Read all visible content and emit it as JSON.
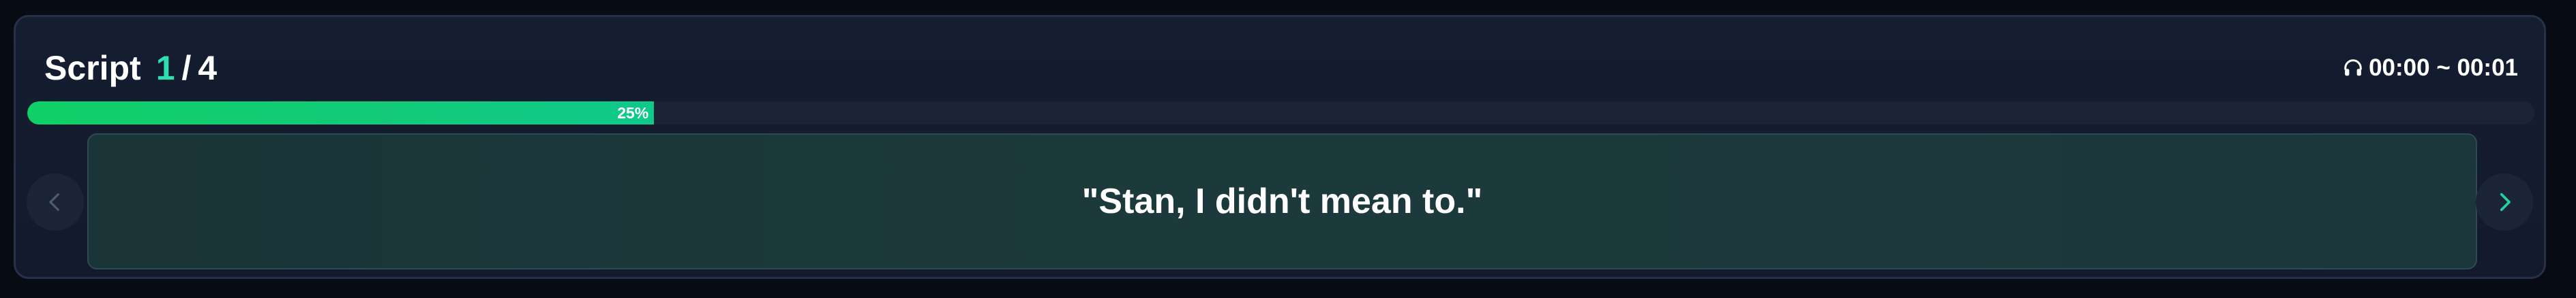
{
  "header": {
    "title_label": "Script",
    "current_index": "1",
    "separator": "/",
    "total": "4"
  },
  "time_range": "00:00 ~ 00:01",
  "progress": {
    "percent": 25,
    "label": "25%"
  },
  "script_line": "\"Stan, I didn't mean to.\"",
  "icons": {
    "time": "headphones-icon",
    "prev": "chevron-left-icon",
    "next": "chevron-right-icon"
  },
  "colors": {
    "accent": "#2ee0b0",
    "progress": "#13c97a",
    "background": "#121a2b"
  }
}
